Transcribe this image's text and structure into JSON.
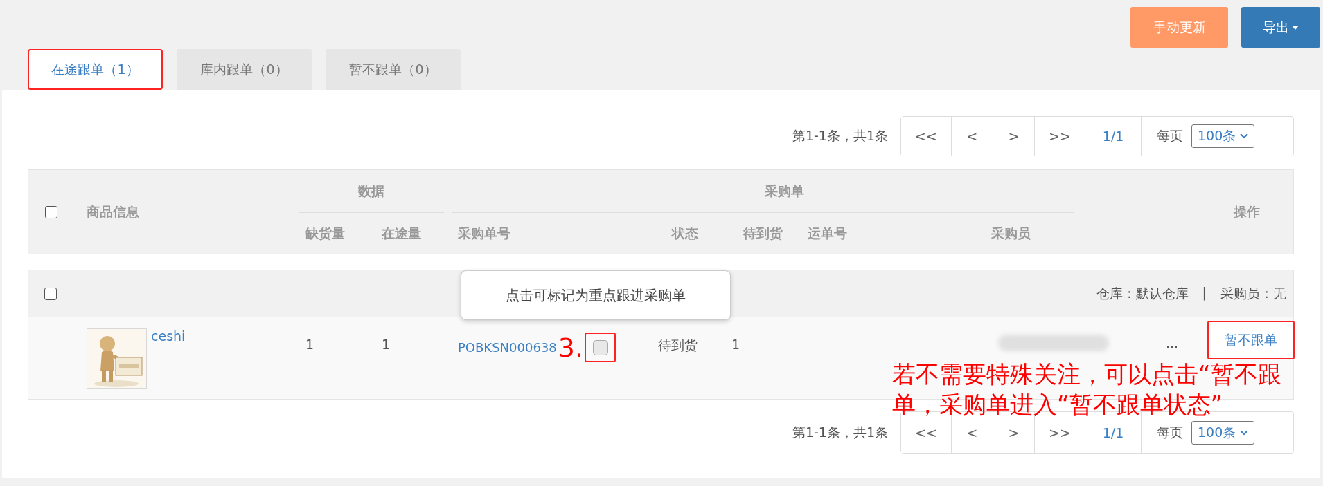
{
  "toolbar_buttons": [
    {
      "kind": "update",
      "label": "手动更新"
    },
    {
      "kind": "export",
      "label": "导出"
    }
  ],
  "tabs": [
    {
      "label": "在途跟单（1）",
      "selected": true,
      "highlighted": true
    },
    {
      "label": "库内跟单（0）",
      "selected": false,
      "highlighted": false
    },
    {
      "label": "暂不跟单（0）",
      "selected": false,
      "highlighted": false
    }
  ],
  "pagination": [
    {
      "summary": "第1-1条，共1条",
      "nav": [
        "<<",
        "<",
        ">",
        ">>"
      ],
      "page": "1/1",
      "per_page_label": "每页",
      "per_page": "100条"
    },
    {
      "summary": "第1-1条，共1条",
      "nav": [
        "<<",
        "<",
        ">",
        ">>"
      ],
      "page": "1/1",
      "per_page_label": "每页",
      "per_page": "100条"
    }
  ],
  "table": {
    "select_all": {
      "checked": false
    },
    "columns": {
      "product": "商品信息",
      "data_group": "数据",
      "shortage": "缺货量",
      "in_transit": "在途量",
      "po_group": "采购单",
      "po_number": "采购单号",
      "status": "状态",
      "pending": "待到货",
      "tracking": "运单号",
      "buyer": "采购员",
      "action": "操作"
    },
    "groups": [
      {
        "checked": false,
        "warehouse": "仓库：默认仓库",
        "separator": "|",
        "buyer": "采购员：无",
        "rows": [
          {
            "product": "ceshi",
            "shortage": "1",
            "in_transit": "1",
            "po_number": "POBKSN000638",
            "marker": "3.",
            "star": {
              "checked": false,
              "highlighted": true
            },
            "status": "待到货",
            "pending": "1",
            "buyer_redacted": true,
            "more": "...",
            "action": {
              "label": "暂不跟单",
              "highlighted": true
            }
          }
        ]
      }
    ]
  },
  "tooltip": "点击可标记为重点跟进采购单",
  "note": {
    "lines": [
      "若不需要特殊关注，可以点击“暂不跟",
      "单，采购单进入“暂不跟单状态”"
    ]
  }
}
